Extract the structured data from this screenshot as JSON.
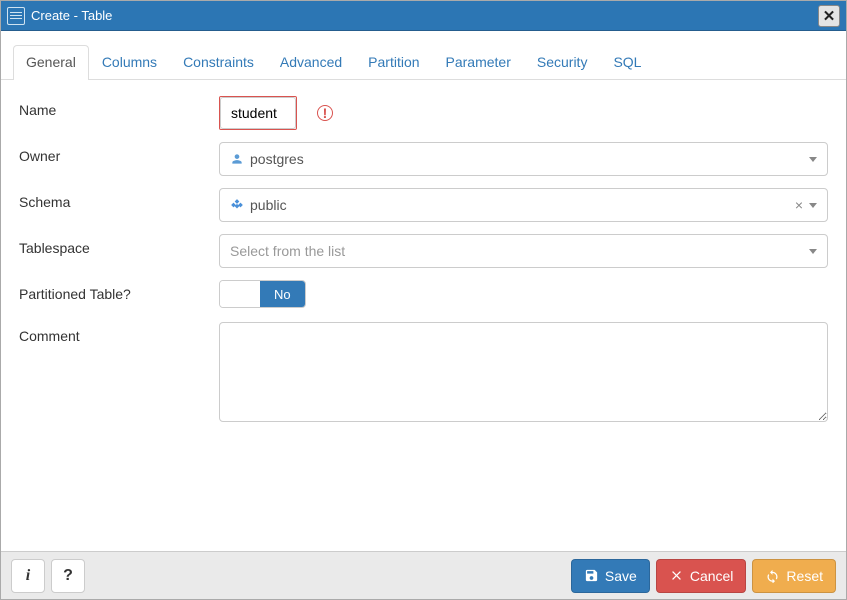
{
  "window": {
    "title": "Create - Table"
  },
  "tabs": {
    "general": "General",
    "columns": "Columns",
    "constraints": "Constraints",
    "advanced": "Advanced",
    "partition": "Partition",
    "parameter": "Parameter",
    "security": "Security",
    "sql": "SQL"
  },
  "labels": {
    "name": "Name",
    "owner": "Owner",
    "schema": "Schema",
    "tablespace": "Tablespace",
    "partitioned": "Partitioned Table?",
    "comment": "Comment"
  },
  "values": {
    "name": "student",
    "owner": "postgres",
    "schema": "public",
    "tablespace_placeholder": "Select from the list",
    "partitioned_toggle": "No",
    "comment": ""
  },
  "footer": {
    "info_char": "i",
    "help_char": "?",
    "save": "Save",
    "cancel": "Cancel",
    "reset": "Reset"
  }
}
